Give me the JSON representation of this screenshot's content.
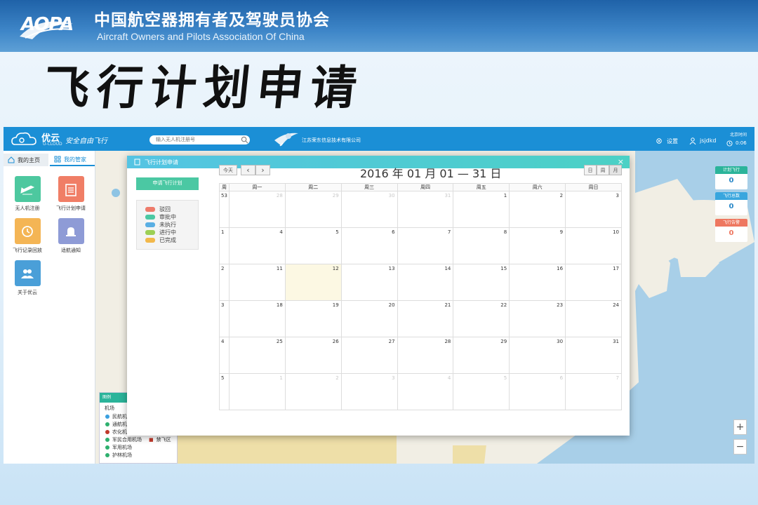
{
  "slide": {
    "logo_text": "AOPA",
    "org_cn": "中国航空器拥有者及驾驶员协会",
    "org_en": "Aircraft Owners and Pilots Association Of China",
    "title": "飞行计划申请"
  },
  "topbar": {
    "brand": "优云",
    "brand_sub": "U-CLOUD",
    "slogan": "安全自由飞行",
    "search_placeholder": "输入无人机注册号",
    "company": "江苏荣东信息技术有限公司",
    "settings": "设置",
    "username": "jsjdkd",
    "time_label": "北京时间",
    "time_value": "0:06"
  },
  "left_panel": {
    "tabs": [
      "我的主页",
      "我的管家"
    ],
    "tiles": [
      {
        "label": "无人机注册",
        "color": "#4dc89f",
        "icon": "drone-icon"
      },
      {
        "label": "飞行计划申请",
        "color": "#f07e66",
        "icon": "clipboard-icon"
      },
      {
        "label": "飞行记录回放",
        "color": "#f4b555",
        "icon": "history-icon"
      },
      {
        "label": "适航通知",
        "color": "#8e9bd6",
        "icon": "bell-icon"
      },
      {
        "label": "关于优云",
        "color": "#4a9fd8",
        "icon": "people-icon"
      }
    ]
  },
  "map_legend": {
    "header": "图例",
    "title": "机场",
    "items": [
      {
        "label": "民航机场",
        "color": "#3aa0e0"
      },
      {
        "label": "通航机场",
        "color": "#2eb06e"
      },
      {
        "label": "农化机场",
        "color": "#c0392b"
      },
      {
        "label": "军民合用机场",
        "color": "#2eb06e"
      },
      {
        "label": "军用机场",
        "color": "#2eb06e"
      },
      {
        "label": "护林机场",
        "color": "#2eb06e"
      }
    ],
    "extra": "禁飞区"
  },
  "widgets": [
    {
      "label": "计划飞行",
      "value": "0",
      "color": "#2bb49a",
      "value_color": "#2a88c8"
    },
    {
      "label": "飞行总数",
      "value": "0",
      "color": "#39a6de",
      "value_color": "#2a88c8"
    },
    {
      "label": "飞行告警",
      "value": "0",
      "color": "#ee7760",
      "value_color": "#ee7760"
    }
  ],
  "zoom": {
    "in": "+",
    "out": "−"
  },
  "dialog": {
    "title": "飞行计划申请",
    "close": "×",
    "apply_button": "申请飞行计划",
    "statuses": [
      {
        "label": "驳回",
        "color": "#ee7b6b"
      },
      {
        "label": "审批中",
        "color": "#4bc8a3"
      },
      {
        "label": "未执行",
        "color": "#5aaee3"
      },
      {
        "label": "进行中",
        "color": "#9ccf55"
      },
      {
        "label": "已完成",
        "color": "#f2b84b"
      }
    ],
    "calendar": {
      "today_btn": "今天",
      "prev": "‹",
      "next": "›",
      "title": "2016 年 01 月 01 — 31 日",
      "views": [
        "日",
        "周",
        "月"
      ],
      "week_col": "周",
      "weekdays": [
        "周一",
        "周二",
        "周三",
        "周四",
        "周五",
        "周六",
        "周日"
      ],
      "rows": [
        {
          "week": "53",
          "days": [
            {
              "d": "28",
              "o": true
            },
            {
              "d": "29",
              "o": true
            },
            {
              "d": "30",
              "o": true
            },
            {
              "d": "31",
              "o": true
            },
            {
              "d": "1"
            },
            {
              "d": "2"
            },
            {
              "d": "3"
            }
          ]
        },
        {
          "week": "1",
          "days": [
            {
              "d": "4"
            },
            {
              "d": "5"
            },
            {
              "d": "6"
            },
            {
              "d": "7"
            },
            {
              "d": "8"
            },
            {
              "d": "9"
            },
            {
              "d": "10"
            }
          ]
        },
        {
          "week": "2",
          "days": [
            {
              "d": "11"
            },
            {
              "d": "12",
              "t": true
            },
            {
              "d": "13"
            },
            {
              "d": "14"
            },
            {
              "d": "15"
            },
            {
              "d": "16"
            },
            {
              "d": "17"
            }
          ]
        },
        {
          "week": "3",
          "days": [
            {
              "d": "18"
            },
            {
              "d": "19"
            },
            {
              "d": "20"
            },
            {
              "d": "21"
            },
            {
              "d": "22"
            },
            {
              "d": "23"
            },
            {
              "d": "24"
            }
          ]
        },
        {
          "week": "4",
          "days": [
            {
              "d": "25"
            },
            {
              "d": "26"
            },
            {
              "d": "27"
            },
            {
              "d": "28"
            },
            {
              "d": "29"
            },
            {
              "d": "30"
            },
            {
              "d": "31"
            }
          ]
        },
        {
          "week": "5",
          "days": [
            {
              "d": "1",
              "o": true
            },
            {
              "d": "2",
              "o": true
            },
            {
              "d": "3",
              "o": true
            },
            {
              "d": "4",
              "o": true
            },
            {
              "d": "5",
              "o": true
            },
            {
              "d": "6",
              "o": true
            },
            {
              "d": "7",
              "o": true
            }
          ]
        }
      ]
    }
  }
}
